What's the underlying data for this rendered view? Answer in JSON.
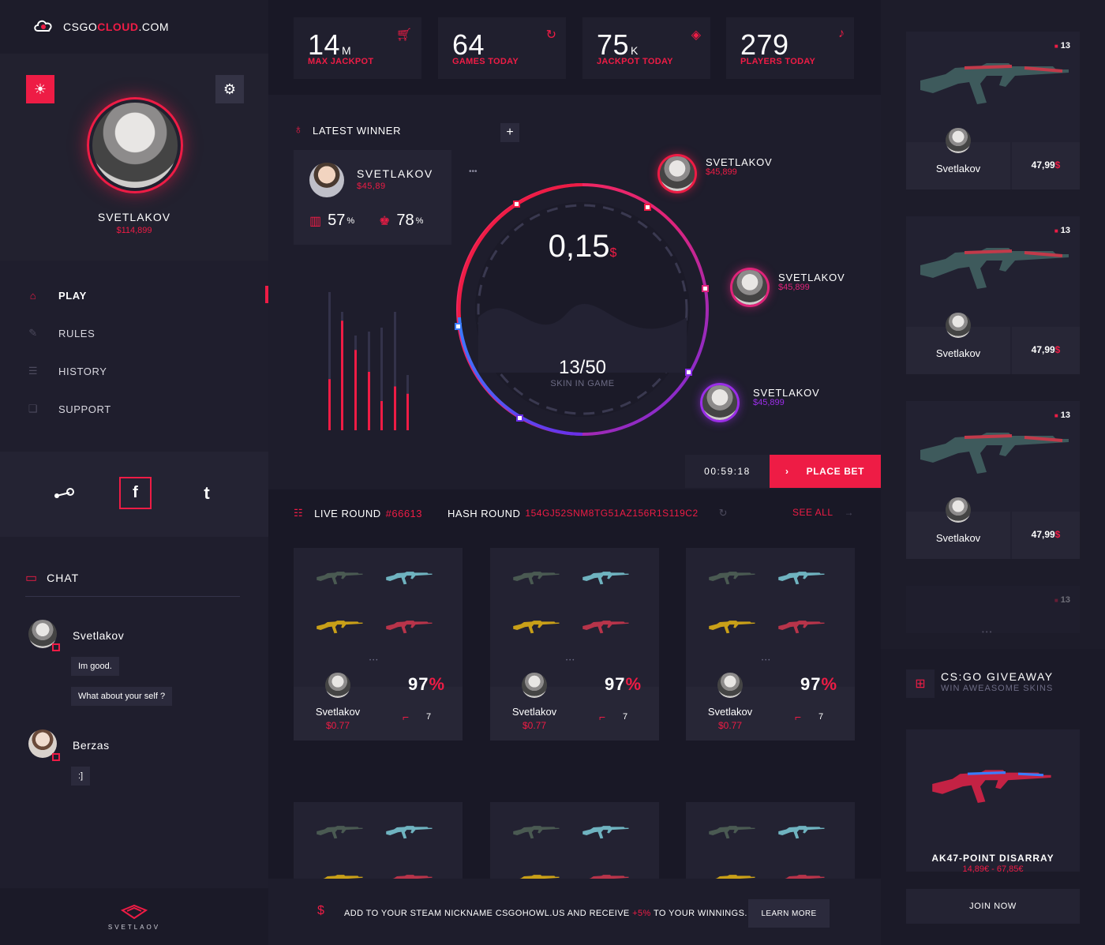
{
  "logo": {
    "prefix": "CSGO",
    "highlight": "CLOUD",
    "suffix": ".COM"
  },
  "profile": {
    "name": "SVETLAKOV",
    "balance": "$114,899"
  },
  "nav": [
    {
      "label": "PLAY",
      "icon": "home-icon",
      "active": true
    },
    {
      "label": "RULES",
      "icon": "edit-icon"
    },
    {
      "label": "HISTORY",
      "icon": "list-icon"
    },
    {
      "label": "SUPPORT",
      "icon": "chat-bubbles-icon"
    }
  ],
  "social": [
    "steam-icon",
    "facebook-icon",
    "tumblr-icon"
  ],
  "chat": {
    "title": "CHAT",
    "messages": [
      {
        "user": "Svetlakov",
        "lines": [
          "Im good.",
          "What about your self ?"
        ]
      },
      {
        "user": "Berzas",
        "lines": [
          ":]"
        ]
      }
    ]
  },
  "brand": "SVETLAOV",
  "stats": [
    {
      "num": "14",
      "unit": "M",
      "label": "MAX JACKPOT",
      "icon": "cart-icon"
    },
    {
      "num": "64",
      "unit": "",
      "label": "GAMES TODAY",
      "icon": "refresh-icon"
    },
    {
      "num": "75",
      "unit": "K",
      "label": "JACKPOT TODAY",
      "icon": "gem-icon"
    },
    {
      "num": "279",
      "unit": "",
      "label": "PLAYERS TODAY",
      "icon": "bell-icon"
    }
  ],
  "latest_winner": {
    "title": "LATEST WINNER",
    "name": "SVETLAKOV",
    "amount": "$45,89",
    "stat1": "57",
    "stat1_unit": "%",
    "stat2": "78",
    "stat2_unit": "%"
  },
  "jackpot": {
    "value": "0,15",
    "currency": "$",
    "progress": "13/50",
    "progress_label": "SKIN IN GAME",
    "progress_fraction": 0.26,
    "bar_levels": [
      0.35,
      0.75,
      0.55,
      0.4,
      0.2,
      0.3,
      0.25
    ],
    "players": [
      {
        "name": "SVETLAKOV",
        "amount": "$45,899"
      },
      {
        "name": "SVETLAKOV",
        "amount": "$45,899"
      },
      {
        "name": "SVETLAKOV",
        "amount": "$45,899"
      }
    ]
  },
  "timer": "00:59:18",
  "place_bet": "PLACE BET",
  "live_round": {
    "label": "LIVE ROUND",
    "id": "#66613",
    "hash_label": "HASH ROUND",
    "hash": "154GJ52SNM8TG51AZ156R1S119C2",
    "see_all": "SEE ALL"
  },
  "round_cards": [
    {
      "user": "Svetlakov",
      "value": "$0.77",
      "pct": "97",
      "pct_sign": "%",
      "count": "7"
    },
    {
      "user": "Svetlakov",
      "value": "$0.77",
      "pct": "97",
      "pct_sign": "%",
      "count": "7"
    },
    {
      "user": "Svetlakov",
      "value": "$0.77",
      "pct": "97",
      "pct_sign": "%",
      "count": "7"
    }
  ],
  "banner": {
    "pre": "ADD TO YOUR STEAM NICKNAME CSGOHOWL.US AND RECEIVE",
    "pct": "+5%",
    "post": "TO YOUR WINNINGS.",
    "button": "LEARN MORE"
  },
  "weapons": [
    {
      "tag": "13",
      "user": "Svetlakov",
      "price": "47,99",
      "currency": "$"
    },
    {
      "tag": "13",
      "user": "Svetlakov",
      "price": "47,99",
      "currency": "$"
    },
    {
      "tag": "13",
      "user": "Svetlakov",
      "price": "47,99",
      "currency": "$"
    },
    {
      "tag": "13"
    }
  ],
  "giveaway": {
    "title": "CS:GO GIVEAWAY",
    "subtitle": "WIN AWEASOME SKINS",
    "item": "AK47-POINT DISARRAY",
    "price": "14,89€ - 67,85€",
    "button": "JOIN NOW"
  }
}
